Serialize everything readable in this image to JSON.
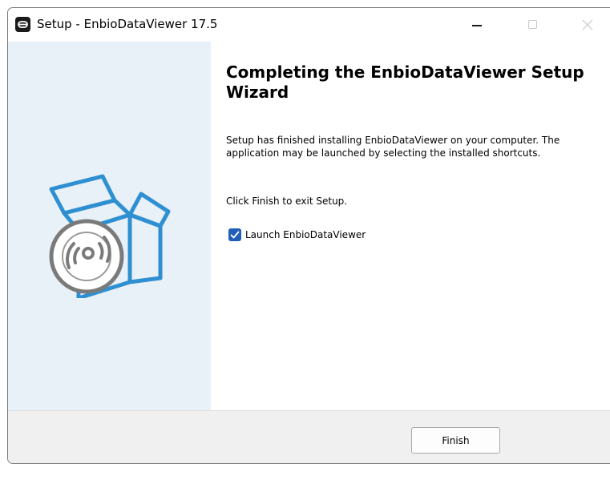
{
  "window": {
    "title": "Setup - EnbioDataViewer 17.5",
    "app_icon": "app-icon",
    "controls": [
      "minimize-icon",
      "maximize-icon",
      "close-icon"
    ]
  },
  "sidebar": {
    "illustration": "software-box-with-disc-icon",
    "colors": {
      "background": "#e8f1f8",
      "box": "#2e8fd1",
      "disc": "#7a7a7a"
    }
  },
  "content": {
    "heading": "Completing the EnbioDataViewer Setup Wizard",
    "paragraph1": "Setup has finished installing EnbioDataViewer on your computer. The application may be launched by selecting the installed shortcuts.",
    "paragraph2": "Click Finish to exit Setup.",
    "launch_checkbox": {
      "label": "Launch EnbioDataViewer",
      "checked": true
    }
  },
  "footer": {
    "finish_label": "Finish"
  },
  "colors": {
    "accent": "#1f5fb5"
  }
}
